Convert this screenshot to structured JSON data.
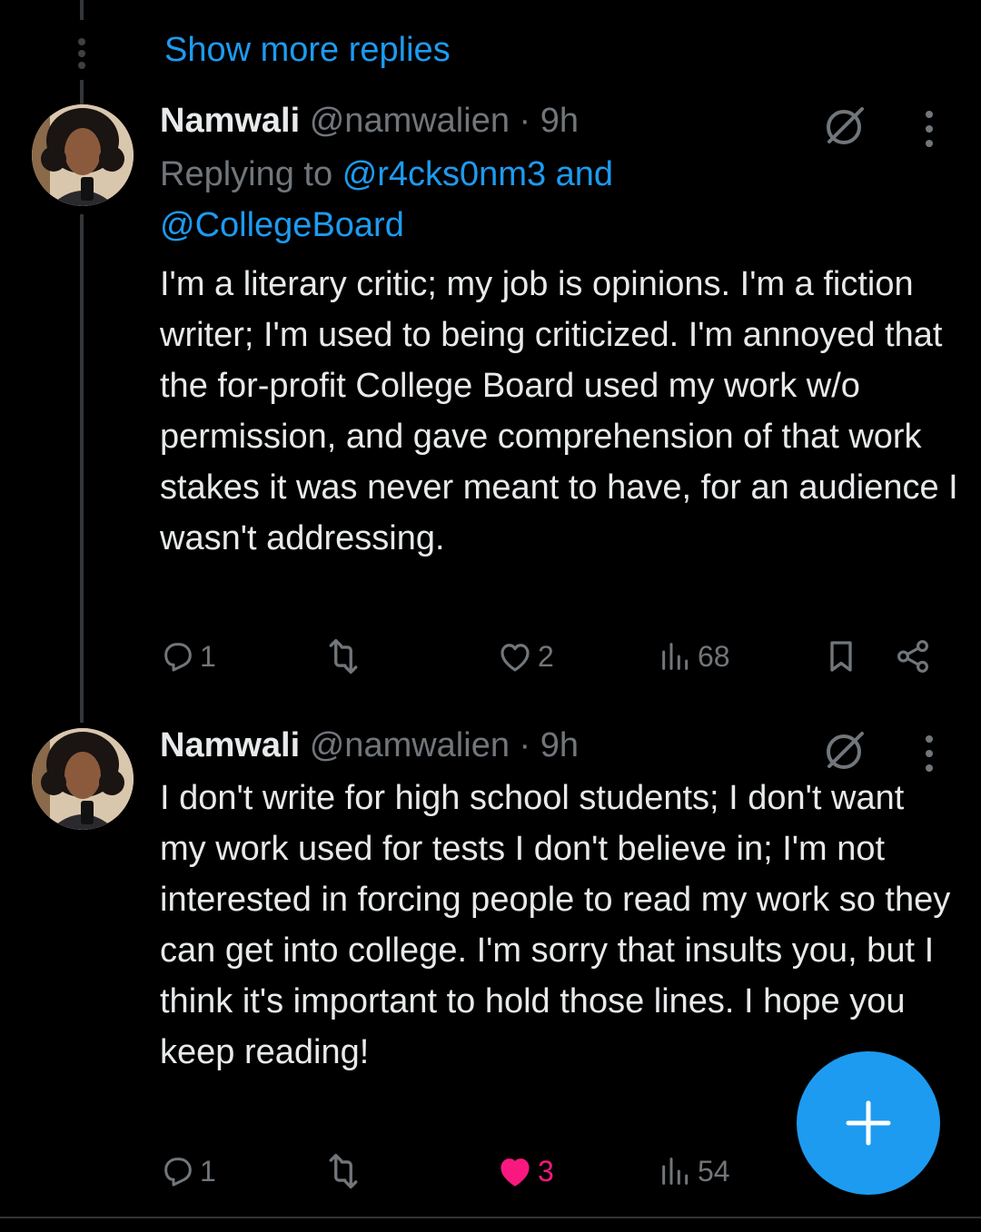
{
  "thread": {
    "show_more": "Show more replies"
  },
  "tweets": [
    {
      "name": "Namwali",
      "handle": "@namwalien",
      "time": "· 9h",
      "replying_prefix": "Replying to",
      "replying_to_1": "@r4cks0nm3 and",
      "replying_to_2": "@CollegeBoard",
      "text": "I'm a literary critic; my job is opinions. I'm a fiction writer; I'm used to being criticized. I'm annoyed that the for-profit College Board used my work w/o permission, and gave comprehension of that work stakes it was never meant to have, for an audience I wasn't addressing.",
      "replies": "1",
      "likes": "2",
      "views": "68",
      "liked": false
    },
    {
      "name": "Namwali",
      "handle": "@namwalien",
      "time": "· 9h",
      "text": "I don't write for high school students; I don't want my work used for tests I don't believe in; I'm not interested in forcing people to read my work so they can get into college. I'm sorry that insults you, but I think it's important to hold those lines. I hope you keep reading!",
      "replies": "1",
      "likes": "3",
      "views": "54",
      "liked": true
    }
  ],
  "icons": {
    "reply": "reply-icon",
    "retweet": "retweet-icon",
    "like": "heart-icon",
    "views": "views-icon",
    "bookmark": "bookmark-icon",
    "share": "share-icon",
    "grok": "grok-icon",
    "more": "more-icon",
    "compose": "plus-icon"
  },
  "colors": {
    "accent": "#1d9bf0",
    "like": "#f91880",
    "muted": "#71767b",
    "background": "#000000"
  }
}
